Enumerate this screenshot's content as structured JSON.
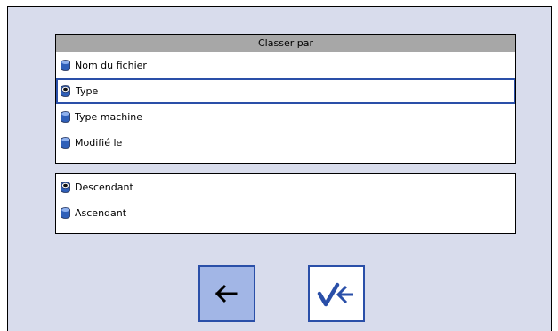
{
  "sort_by": {
    "title": "Classer par",
    "options": [
      {
        "label": "Nom du fichier",
        "selected": false,
        "focused": false
      },
      {
        "label": "Type",
        "selected": true,
        "focused": true
      },
      {
        "label": "Type machine",
        "selected": false,
        "focused": false
      },
      {
        "label": "Modifié le",
        "selected": false,
        "focused": false
      }
    ]
  },
  "order": {
    "options": [
      {
        "label": "Descendant",
        "selected": true
      },
      {
        "label": "Ascendant",
        "selected": false
      }
    ]
  },
  "buttons": {
    "back_icon": "left-arrow-icon",
    "confirm_icon": "check-left-arrow-icon"
  },
  "colors": {
    "panel_bg": "#d8dcec",
    "header_bg": "#a7a7a7",
    "accent": "#2a4fa8",
    "back_button_bg": "#a2b6e6"
  }
}
